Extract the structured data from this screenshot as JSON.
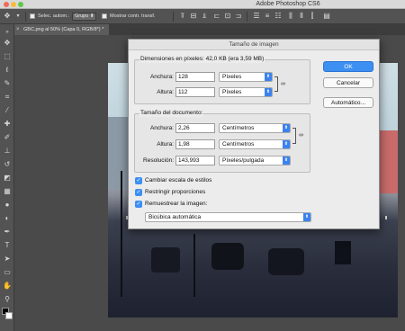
{
  "window": {
    "app_title": "Adobe Photoshop CS6"
  },
  "options_bar": {
    "select_label": "Selec. autom.:",
    "group_value": "Grupo",
    "transform_label": "Mostrar contr. transf."
  },
  "document_tab": {
    "label": "GBC.png al 50% (Capa 0, RGB/8*) *"
  },
  "dialog": {
    "title": "Tamaño de imagen",
    "pixel_dims": {
      "legend": "Dimensiones en píxeles: 42,0 KB (era 3,59 MB)",
      "width_label": "Anchura:",
      "width_value": "128",
      "width_unit": "Píxeles",
      "height_label": "Altura:",
      "height_value": "112",
      "height_unit": "Píxeles"
    },
    "doc_size": {
      "legend": "Tamaño del documento:",
      "width_label": "Anchura:",
      "width_value": "2,26",
      "width_unit": "Centímetros",
      "height_label": "Altura:",
      "height_value": "1,98",
      "height_unit": "Centímetros",
      "res_label": "Resolución:",
      "res_value": "143,993",
      "res_unit": "Píxeles/pulgada"
    },
    "checkboxes": [
      {
        "label": "Cambiar escala de estilos"
      },
      {
        "label": "Restringir proporciones"
      },
      {
        "label": "Remuestrear la imagen:"
      }
    ],
    "resample_method": "Bicúbica automática",
    "buttons": {
      "ok": "OK",
      "cancel": "Cancelar",
      "auto": "Automático..."
    }
  },
  "icons": {
    "link": "chain-link-icon",
    "tools": [
      "move-icon",
      "marquee-icon",
      "lasso-icon",
      "quick-select-icon",
      "crop-icon",
      "eyedropper-icon",
      "healing-icon",
      "brush-icon",
      "stamp-icon",
      "history-brush-icon",
      "eraser-icon",
      "gradient-icon",
      "blur-icon",
      "dodge-icon",
      "pen-icon",
      "type-icon",
      "path-select-icon",
      "shape-icon",
      "hand-icon",
      "zoom-icon"
    ]
  },
  "colors": {
    "accent": "#3d8ff2",
    "foreground_swatch": "#000000",
    "background_swatch": "#ffffff"
  }
}
